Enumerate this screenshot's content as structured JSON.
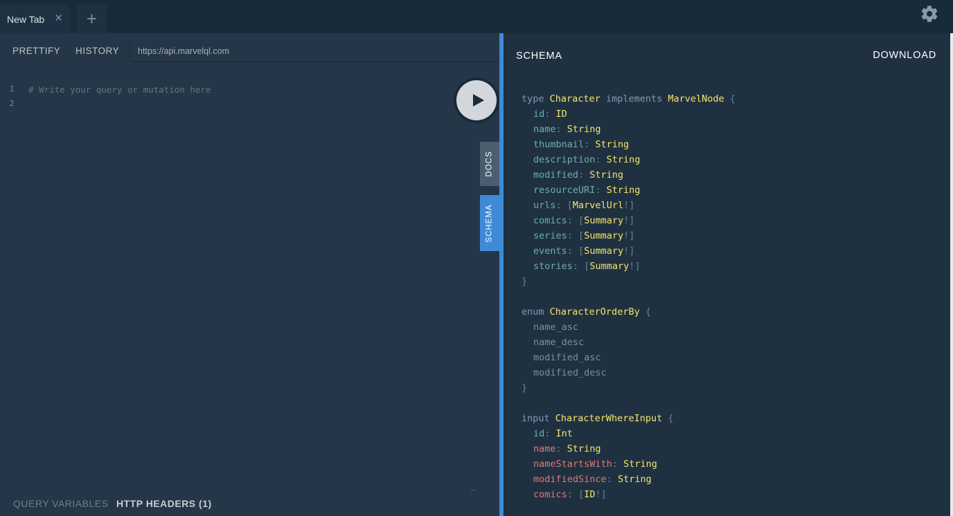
{
  "tabs": {
    "active_label": "New Tab",
    "close_symbol": "✕",
    "new_tab_symbol": "+"
  },
  "toolbar": {
    "prettify_label": "PRETTIFY",
    "history_label": "HISTORY",
    "endpoint_url": "https://api.marvelql.com"
  },
  "editor": {
    "lines": [
      {
        "number": "1",
        "text": "# Write your query or mutation here"
      },
      {
        "number": "2",
        "text": ""
      }
    ]
  },
  "side_tabs": {
    "docs_label": "DOCS",
    "schema_label": "SCHEMA"
  },
  "bottom": {
    "query_variables_label": "QUERY VARIABLES",
    "http_headers_label": "HTTP HEADERS (1)"
  },
  "schema_panel": {
    "title": "SCHEMA",
    "download_label": "DOWNLOAD",
    "type_character": {
      "keyword": "type",
      "name": "Character",
      "implements_kw": "implements",
      "interface": "MarvelNode",
      "fields": [
        {
          "name": "id",
          "type": "ID",
          "list": false
        },
        {
          "name": "name",
          "type": "String",
          "list": false
        },
        {
          "name": "thumbnail",
          "type": "String",
          "list": false
        },
        {
          "name": "description",
          "type": "String",
          "list": false
        },
        {
          "name": "modified",
          "type": "String",
          "list": false
        },
        {
          "name": "resourceURI",
          "type": "String",
          "list": false
        },
        {
          "name": "urls",
          "type": "MarvelUrl",
          "list": true
        },
        {
          "name": "comics",
          "type": "Summary",
          "list": true
        },
        {
          "name": "series",
          "type": "Summary",
          "list": true
        },
        {
          "name": "events",
          "type": "Summary",
          "list": true
        },
        {
          "name": "stories",
          "type": "Summary",
          "list": true
        }
      ]
    },
    "enum_order": {
      "keyword": "enum",
      "name": "CharacterOrderBy",
      "values": [
        "name_asc",
        "name_desc",
        "modified_asc",
        "modified_desc"
      ]
    },
    "input_where": {
      "keyword": "input",
      "name": "CharacterWhereInput",
      "fields": [
        {
          "name": "id",
          "type": "Int",
          "list": false
        },
        {
          "name": "name",
          "type": "String",
          "list": false
        },
        {
          "name": "nameStartsWith",
          "type": "String",
          "list": false
        },
        {
          "name": "modifiedSince",
          "type": "String",
          "list": false
        },
        {
          "name": "comics",
          "type": "ID",
          "list": true
        }
      ]
    }
  },
  "icons": {
    "settings": "gear-icon",
    "run": "play-icon"
  },
  "colors": {
    "accent": "#3f8ad7",
    "type_name": "#f5e66a",
    "field_name": "#6fb0a4",
    "input_field_name": "#e07777"
  }
}
